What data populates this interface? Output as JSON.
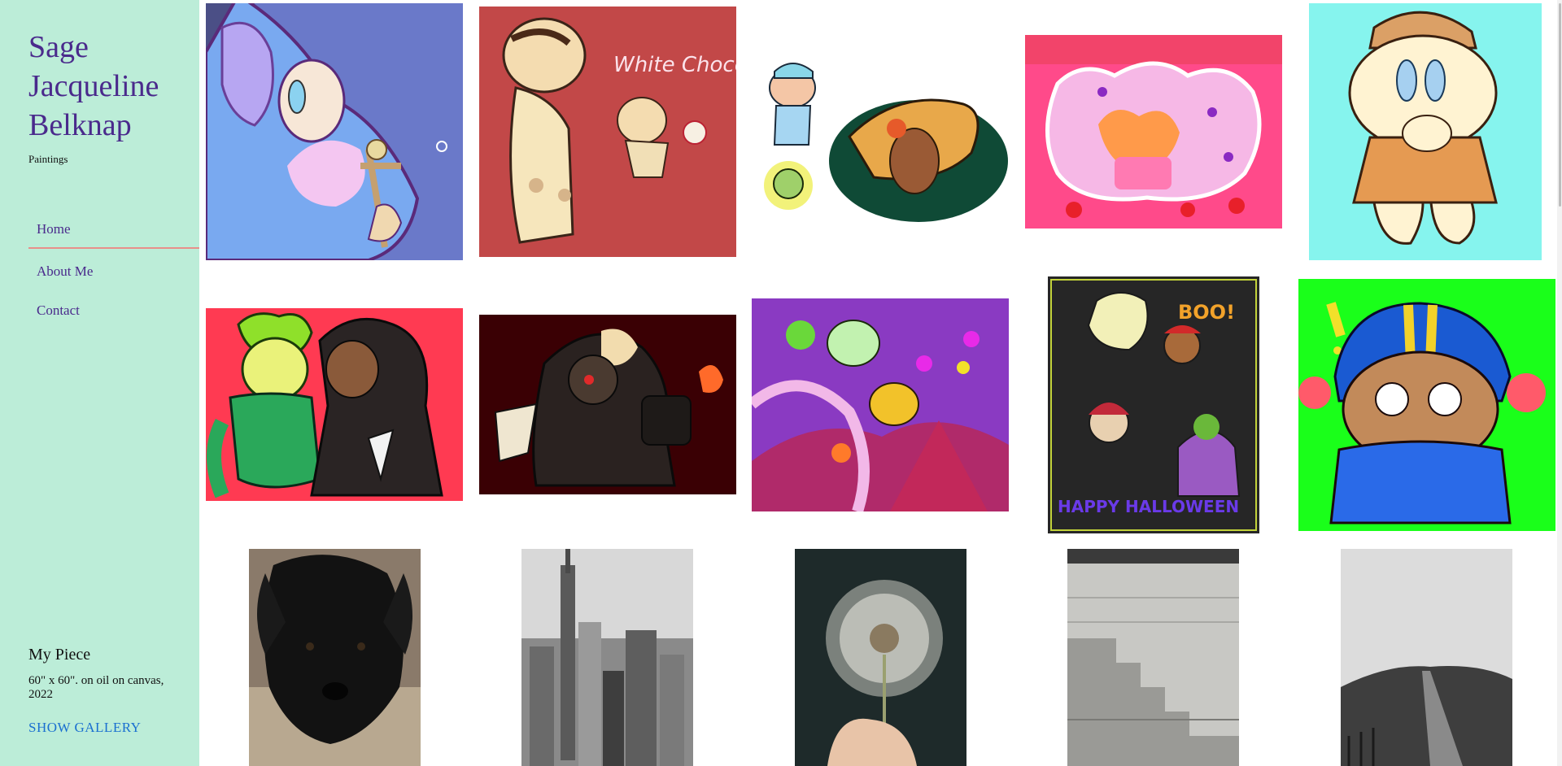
{
  "site": {
    "title": "Sage Jacqueline Belknap",
    "subtitle": "Paintings"
  },
  "nav": {
    "items": [
      {
        "label": "Home",
        "active": true
      },
      {
        "label": "About Me",
        "active": false
      },
      {
        "label": "Contact",
        "active": false
      }
    ]
  },
  "piece": {
    "title": "My Piece",
    "description": "60\" x 60\". on oil on canvas, 2022",
    "link_label": "SHOW GALLERY"
  },
  "gallery": {
    "row1": [
      {
        "name": "pastel-character-artwork"
      },
      {
        "name": "white-chocolate-cookie-artwork"
      },
      {
        "name": "fish-and-cookies-artwork"
      },
      {
        "name": "pink-hearts-cloud-artwork"
      },
      {
        "name": "mushroom-cookie-artwork"
      }
    ],
    "row1_text": {
      "handwriting": "White Chocolate"
    },
    "row2": [
      {
        "name": "green-and-dark-duo-artwork"
      },
      {
        "name": "dark-knight-cookie-artwork"
      },
      {
        "name": "carnival-rollercoaster-artwork"
      },
      {
        "name": "happy-halloween-artwork"
      },
      {
        "name": "helmet-cookie-artwork"
      }
    ],
    "row2_text": {
      "boo": "BOO!",
      "halloween": "HAPPY HALLOWEEN"
    },
    "row3": [
      {
        "name": "black-puppy-photo"
      },
      {
        "name": "city-skyline-photo"
      },
      {
        "name": "dandelion-photo"
      },
      {
        "name": "stone-wall-stairs-photo"
      },
      {
        "name": "hill-path-photo"
      }
    ]
  },
  "colors": {
    "sidebar_bg": "#bcedd8",
    "title_color": "#4a2a8c",
    "nav_underline": "#e8908a",
    "link_color": "#1a6fd0"
  }
}
